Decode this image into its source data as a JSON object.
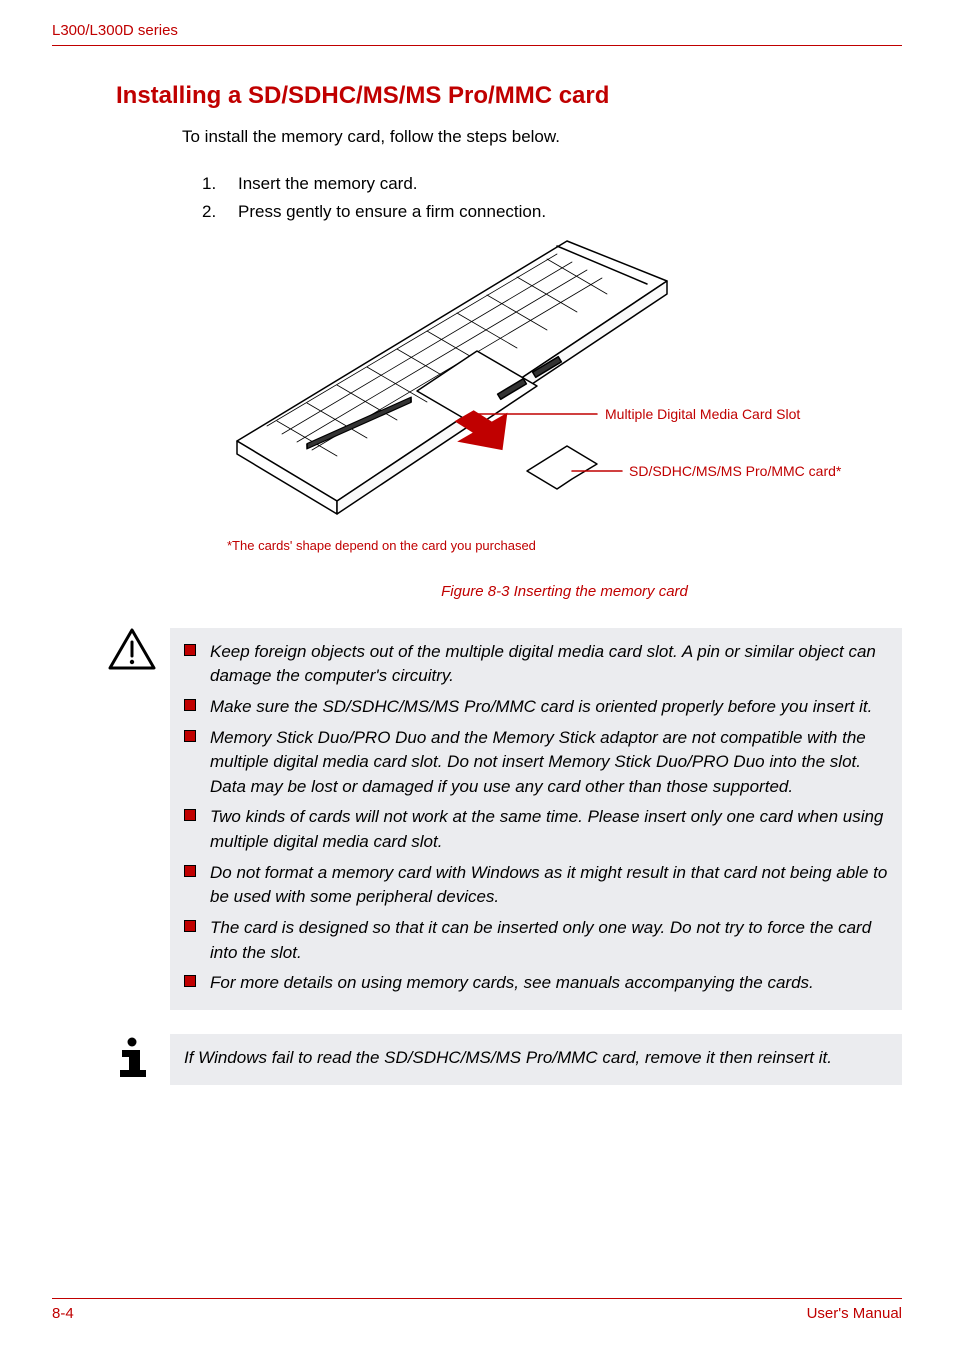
{
  "header": {
    "series": "L300/L300D series"
  },
  "section": {
    "title": "Installing a SD/SDHC/MS/MS Pro/MMC card",
    "intro": "To install the memory card, follow the steps below.",
    "steps": [
      "Insert the memory card.",
      "Press gently to ensure a firm connection."
    ]
  },
  "figure": {
    "annot_slot": "Multiple Digital Media Card Slot",
    "annot_card": "SD/SDHC/MS/MS Pro/MMC card*",
    "footnote": "*The cards' shape depend on the card you purchased",
    "caption": "Figure 8-3 Inserting the memory card"
  },
  "caution": {
    "items": [
      "Keep foreign objects out of the multiple digital media card slot. A pin or similar object can damage the computer's circuitry.",
      "Make sure the SD/SDHC/MS/MS Pro/MMC card is oriented properly before you insert it.",
      "Memory Stick Duo/PRO Duo and the Memory Stick adaptor are not compatible with the multiple digital media card slot. Do not insert Memory Stick Duo/PRO Duo into the slot. Data may be lost or damaged if you use any card other than those supported.",
      "Two kinds of cards will not work at the same time. Please insert only one card when using multiple digital media card slot.",
      "Do not format a memory card with Windows as it might result in that card not being able to be used with some peripheral devices.",
      "The card is designed so that it can be inserted only one way. Do not try to force the card into the slot.",
      "For more details on using memory cards, see manuals accompanying the cards."
    ]
  },
  "info": {
    "text": "If Windows fail to read the SD/SDHC/MS/MS Pro/MMC card, remove it then reinsert it."
  },
  "footer": {
    "page": "8-4",
    "manual": "User's Manual"
  }
}
